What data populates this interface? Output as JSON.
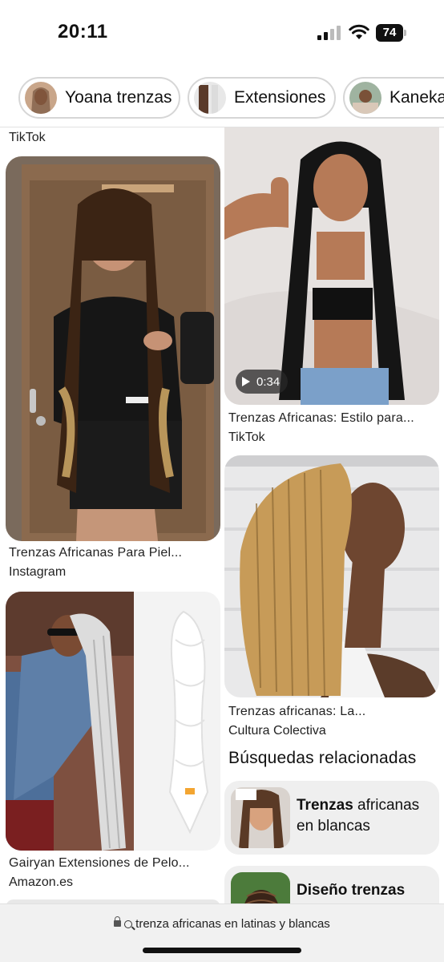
{
  "status_bar": {
    "time": "20:11",
    "battery": "74"
  },
  "chips": [
    {
      "label": "Yoana trenzas"
    },
    {
      "label": "Extensiones"
    },
    {
      "label": "Kanekal"
    }
  ],
  "feed": {
    "top_source": "TikTok",
    "pins": [
      {
        "title": "Trenzas Africanas Para Piel...",
        "source": "Instagram"
      },
      {
        "title": "Trenzas Africanas: Estilo para...",
        "source": "TikTok",
        "video_duration": "0:34"
      },
      {
        "title": "Trenzas africanas: La...",
        "source": "Cultura Colectiva"
      },
      {
        "title": "Gairyan Extensiones de Pelo...",
        "source": "Amazon.es"
      }
    ],
    "related_title": "Búsquedas relacionadas",
    "related": [
      {
        "bold": "Trenzas",
        "rest": " africanas",
        "line2": "en blancas"
      },
      {
        "bold": "Diseño trenzas",
        "rest": "",
        "line2": ""
      }
    ]
  },
  "browser": {
    "url_text": "trenza africanas en latinas y blancas"
  }
}
